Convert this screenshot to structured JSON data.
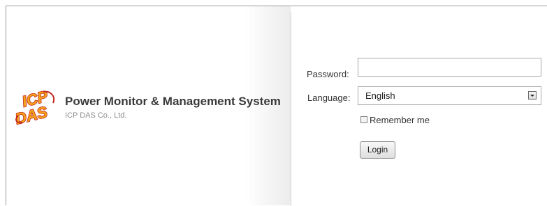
{
  "brand": {
    "logo_text": "ICP DAS",
    "title": "Power Monitor & Management System",
    "subtitle": "ICP DAS Co., Ltd."
  },
  "login": {
    "password_label": "Password:",
    "password_value": "",
    "language_label": "Language:",
    "language_selected": "English",
    "remember_label": "Remember me",
    "remember_checked": false,
    "login_button": "Login"
  },
  "colors": {
    "logo_fill": "#f4a21b",
    "logo_outline": "#c4271e",
    "title_text": "#3a3a3a",
    "subtitle_text": "#8a8a8a"
  },
  "icons": [
    "icp-das-logo",
    "dropdown-arrow-icon",
    "checkbox-icon"
  ]
}
